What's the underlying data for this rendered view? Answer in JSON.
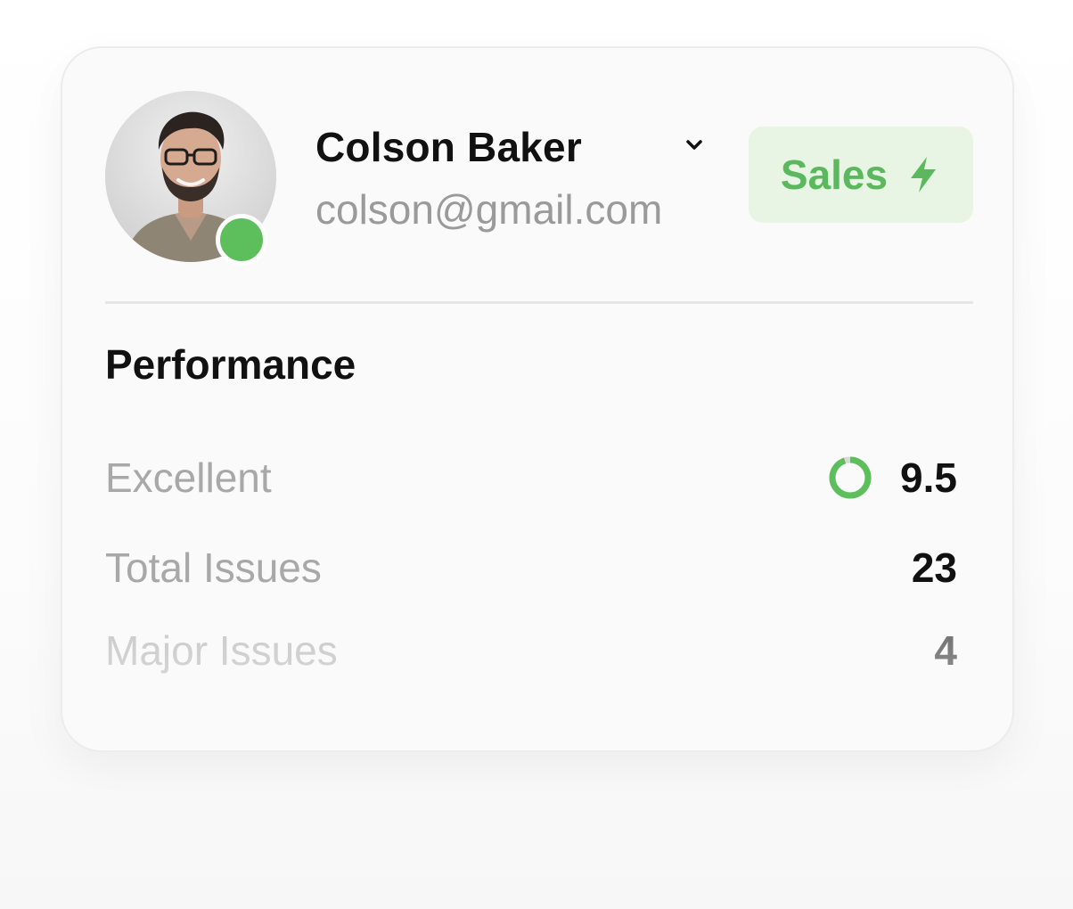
{
  "profile": {
    "name": "Colson Baker",
    "email": "colson@gmail.com",
    "status": "online",
    "avatar": "user-photo"
  },
  "department_badge": {
    "label": "Sales",
    "icon": "lightning-bolt-icon"
  },
  "performance": {
    "title": "Performance",
    "metrics": [
      {
        "label": "Excellent",
        "value": "9.5",
        "score_fraction": 0.95,
        "indicator": "progress-ring-icon"
      },
      {
        "label": "Total Issues",
        "value": "23"
      },
      {
        "label": "Major Issues",
        "value": "4"
      }
    ]
  },
  "colors": {
    "accent_green": "#5cbf5c",
    "badge_background": "#e8f5e5",
    "muted_text": "#a8a8a8"
  }
}
